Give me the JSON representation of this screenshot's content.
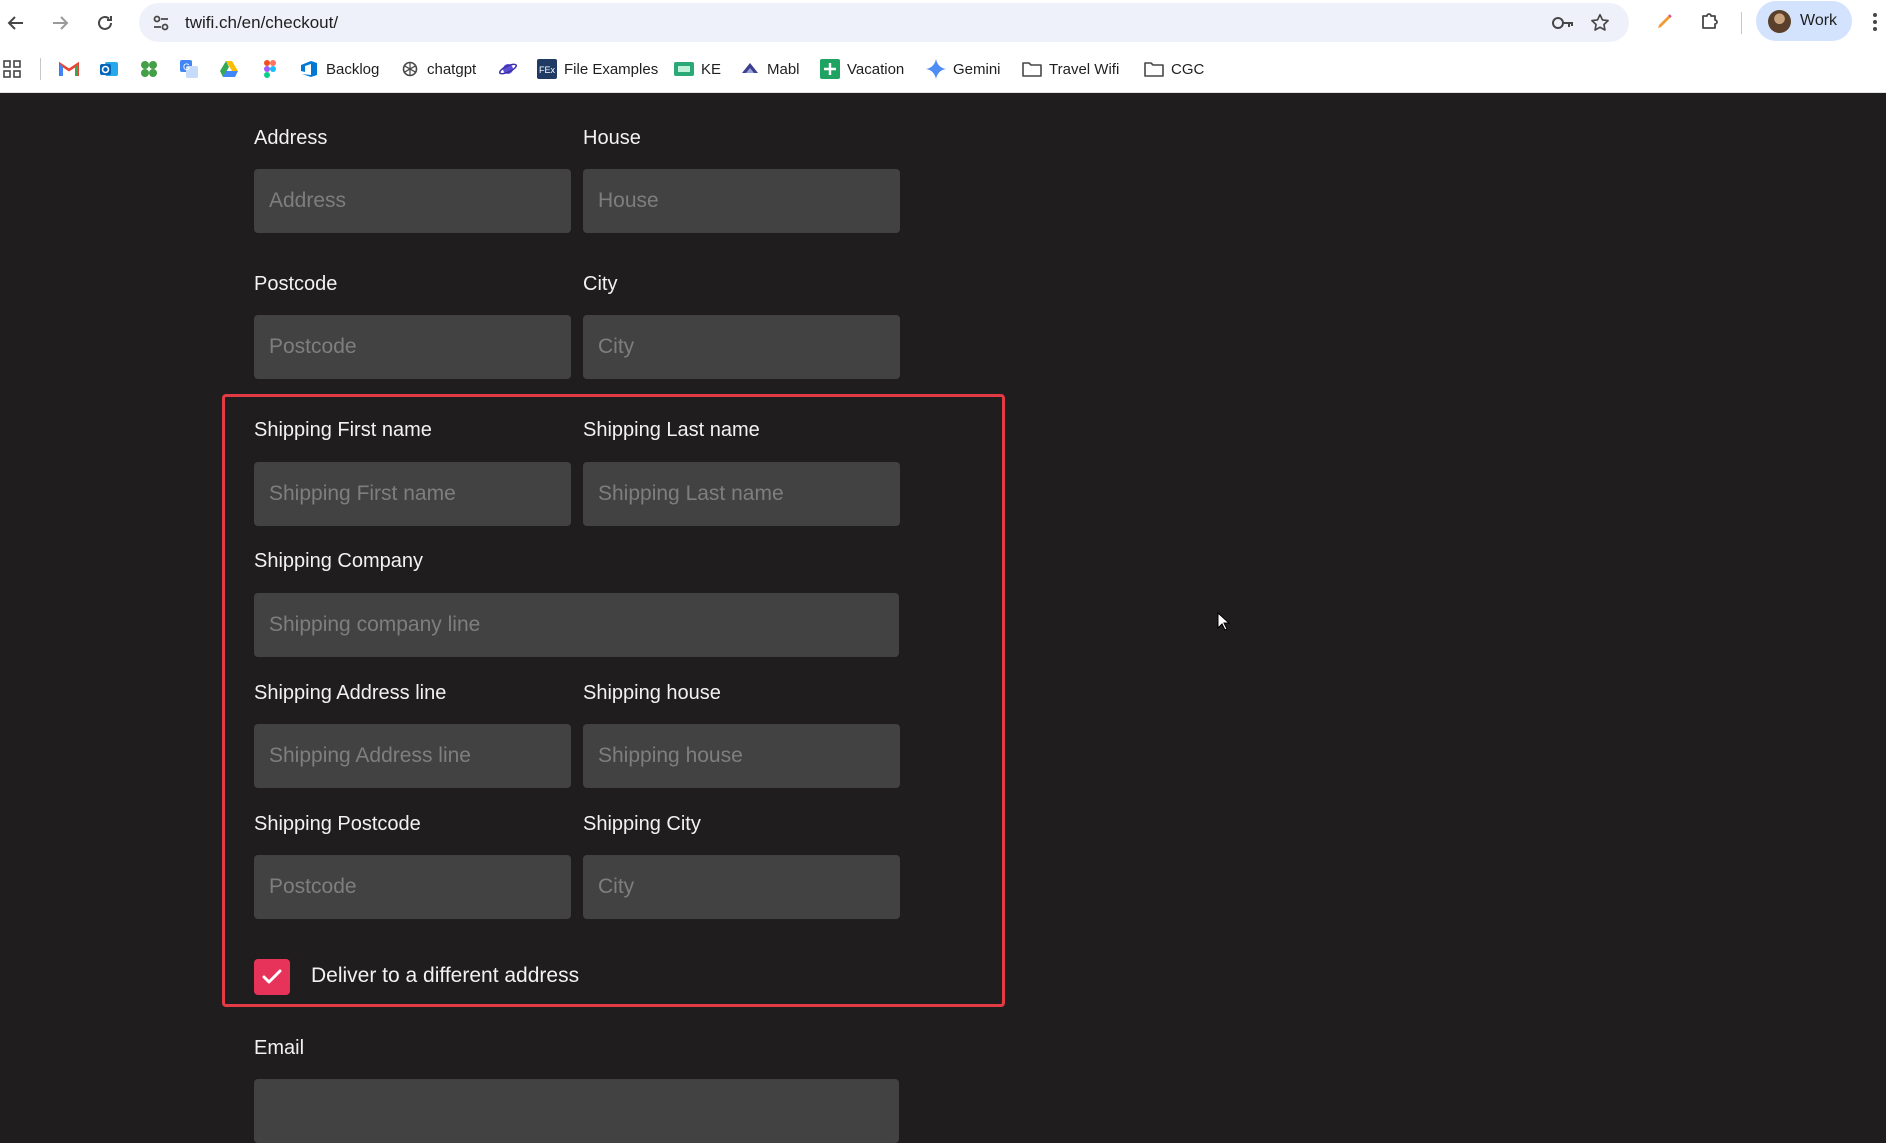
{
  "browser": {
    "url": "twifi.ch/en/checkout/",
    "profile_label": "Work",
    "bookmarks": [
      {
        "label": "",
        "icon": "apps-grid-icon"
      },
      {
        "label": "",
        "icon": "gmail-icon"
      },
      {
        "label": "",
        "icon": "outlook-icon"
      },
      {
        "label": "",
        "icon": "clover-icon"
      },
      {
        "label": "",
        "icon": "translate-icon"
      },
      {
        "label": "",
        "icon": "drive-icon"
      },
      {
        "label": "",
        "icon": "figma-icon"
      },
      {
        "label": "Backlog",
        "icon": "azure-devops-icon"
      },
      {
        "label": "chatgpt",
        "icon": "openai-icon"
      },
      {
        "label": "",
        "icon": "planet-icon"
      },
      {
        "label": "File Examples",
        "icon": "fex-icon"
      },
      {
        "label": "KE",
        "icon": "ke-icon"
      },
      {
        "label": "Mabl",
        "icon": "mabl-icon"
      },
      {
        "label": "Vacation",
        "icon": "sheets-plus-icon"
      },
      {
        "label": "Gemini",
        "icon": "gemini-icon"
      },
      {
        "label": "Travel Wifi",
        "icon": "folder-icon"
      },
      {
        "label": "CGC",
        "icon": "folder-icon"
      }
    ]
  },
  "form": {
    "address": {
      "label": "Address",
      "placeholder": "Address"
    },
    "house": {
      "label": "House",
      "placeholder": "House"
    },
    "postcode": {
      "label": "Postcode",
      "placeholder": "Postcode"
    },
    "city": {
      "label": "City",
      "placeholder": "City"
    },
    "shipping_first_name": {
      "label": "Shipping First name",
      "placeholder": "Shipping First name"
    },
    "shipping_last_name": {
      "label": "Shipping Last name",
      "placeholder": "Shipping Last name"
    },
    "shipping_company": {
      "label": "Shipping Company",
      "placeholder": "Shipping company line"
    },
    "shipping_address": {
      "label": "Shipping Address line",
      "placeholder": "Shipping Address line"
    },
    "shipping_house": {
      "label": "Shipping house",
      "placeholder": "Shipping house"
    },
    "shipping_postcode": {
      "label": "Shipping Postcode",
      "placeholder": "Postcode"
    },
    "shipping_city": {
      "label": "Shipping City",
      "placeholder": "City"
    },
    "deliver_different": {
      "label": "Deliver to a different address",
      "checked": true
    },
    "email": {
      "label": "Email"
    }
  },
  "colors": {
    "page_bg": "#1f1d1e",
    "field_bg": "#434243",
    "highlight": "#e33b45",
    "checkbox": "#e7325a"
  }
}
